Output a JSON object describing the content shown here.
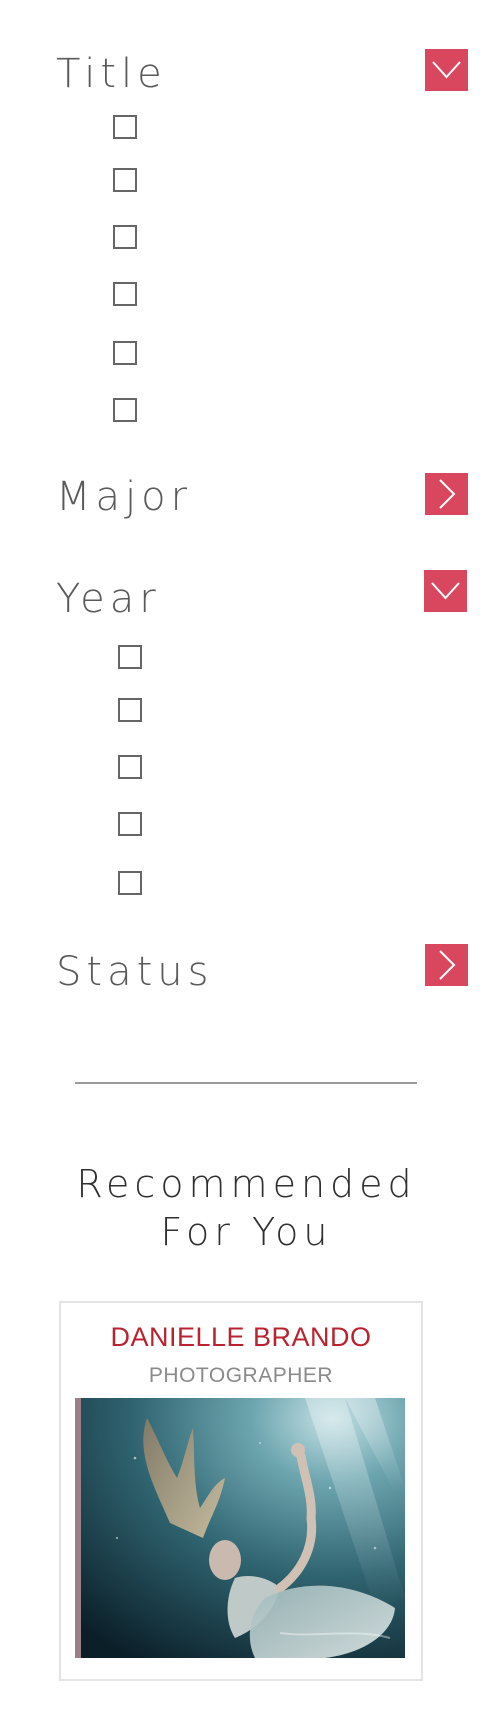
{
  "filters": [
    {
      "title": "Title",
      "expanded": true,
      "toggle_icon": "chevron-down-icon",
      "option_count": 6
    },
    {
      "title": "Major",
      "expanded": false,
      "toggle_icon": "chevron-right-icon",
      "option_count": 0
    },
    {
      "title": "Year",
      "expanded": true,
      "toggle_icon": "chevron-down-icon",
      "option_count": 5
    },
    {
      "title": "Status",
      "expanded": false,
      "toggle_icon": "chevron-right-icon",
      "option_count": 0
    }
  ],
  "recommended": {
    "heading_line1": "Recommended",
    "heading_line2": "For You",
    "card": {
      "name": "DANIELLE BRANDO",
      "role": "PHOTOGRAPHER",
      "image_icon": "underwater-portrait-photo"
    }
  },
  "colors": {
    "accent": "#d9475f",
    "card_name": "#b8232f",
    "text": "#5a5a5a",
    "divider": "#9a9a9a"
  }
}
